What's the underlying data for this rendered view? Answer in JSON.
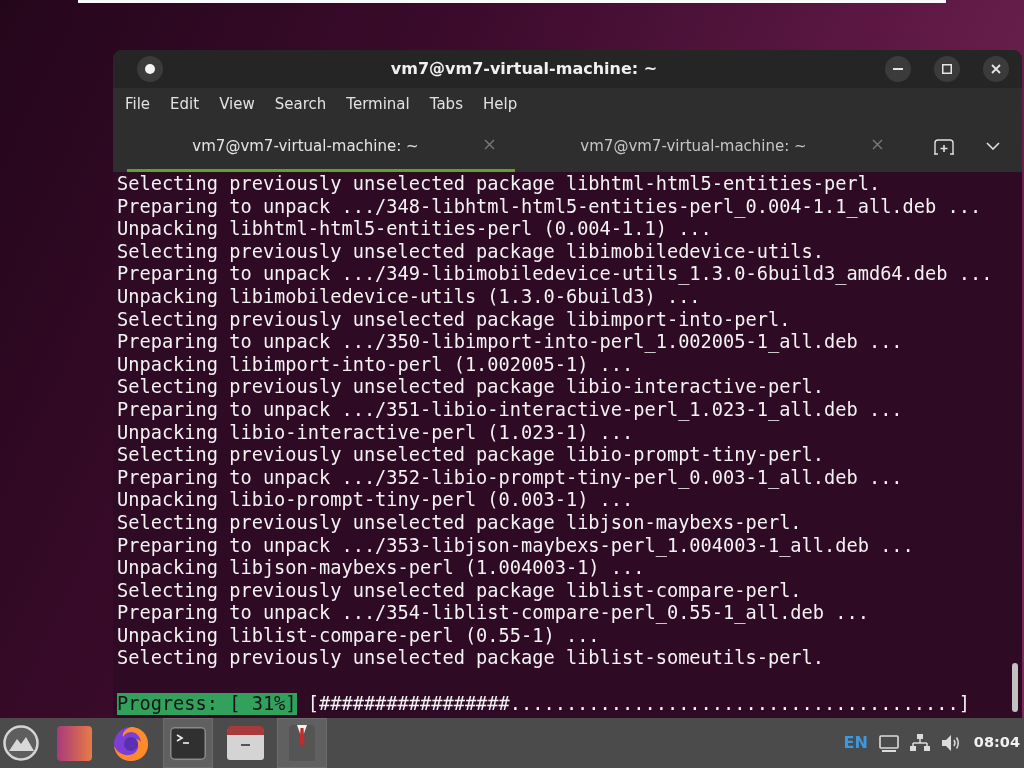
{
  "window": {
    "title": "vm7@vm7-virtual-machine: ~"
  },
  "menu": [
    "File",
    "Edit",
    "View",
    "Search",
    "Terminal",
    "Tabs",
    "Help"
  ],
  "tabs": [
    {
      "label": "vm7@vm7-virtual-machine: ~",
      "selected": true
    },
    {
      "label": "vm7@vm7-virtual-machine: ~",
      "selected": false
    }
  ],
  "terminal": {
    "lines": [
      "Selecting previously unselected package libhtml-html5-entities-perl.",
      "Preparing to unpack .../348-libhtml-html5-entities-perl_0.004-1.1_all.deb ...",
      "Unpacking libhtml-html5-entities-perl (0.004-1.1) ...",
      "Selecting previously unselected package libimobiledevice-utils.",
      "Preparing to unpack .../349-libimobiledevice-utils_1.3.0-6build3_amd64.deb ...",
      "Unpacking libimobiledevice-utils (1.3.0-6build3) ...",
      "Selecting previously unselected package libimport-into-perl.",
      "Preparing to unpack .../350-libimport-into-perl_1.002005-1_all.deb ...",
      "Unpacking libimport-into-perl (1.002005-1) ...",
      "Selecting previously unselected package libio-interactive-perl.",
      "Preparing to unpack .../351-libio-interactive-perl_1.023-1_all.deb ...",
      "Unpacking libio-interactive-perl (1.023-1) ...",
      "Selecting previously unselected package libio-prompt-tiny-perl.",
      "Preparing to unpack .../352-libio-prompt-tiny-perl_0.003-1_all.deb ...",
      "Unpacking libio-prompt-tiny-perl (0.003-1) ...",
      "Selecting previously unselected package libjson-maybexs-perl.",
      "Preparing to unpack .../353-libjson-maybexs-perl_1.004003-1_all.deb ...",
      "Unpacking libjson-maybexs-perl (1.004003-1) ...",
      "Selecting previously unselected package liblist-compare-perl.",
      "Preparing to unpack .../354-liblist-compare-perl_0.55-1_all.deb ...",
      "Unpacking liblist-compare-perl (0.55-1) ...",
      "Selecting previously unselected package liblist-someutils-perl."
    ],
    "progress": {
      "label": "Progress: [ 31%]",
      "bar": "[#################........................................]"
    }
  },
  "taskbar": {
    "apps": [
      {
        "kind": "launcher",
        "open": false
      },
      {
        "kind": "tile",
        "open": false
      },
      {
        "kind": "browser",
        "open": false
      },
      {
        "kind": "terminal",
        "open": true
      },
      {
        "kind": "files",
        "open": false
      },
      {
        "kind": "suit",
        "open": true
      }
    ],
    "keyboard_layout": "EN",
    "clock": "08:04"
  }
}
